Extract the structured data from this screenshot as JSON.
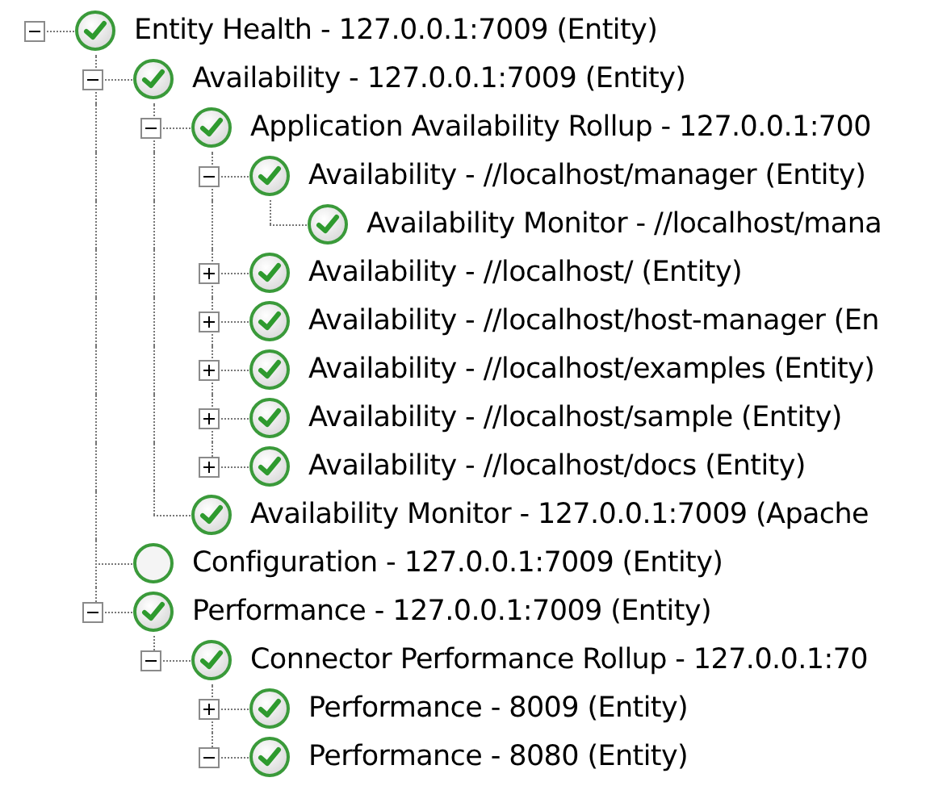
{
  "tree": [
    {
      "label": "Entity Health - 127.0.0.1:7009 (Entity)",
      "healthy": true,
      "expanded": true,
      "children": [
        {
          "label": "Availability - 127.0.0.1:7009 (Entity)",
          "healthy": true,
          "expanded": true,
          "children": [
            {
              "label": "Application Availability Rollup - 127.0.0.1:700",
              "healthy": true,
              "expanded": true,
              "children": [
                {
                  "label": "Availability - //localhost/manager (Entity)",
                  "healthy": true,
                  "expanded": true,
                  "children": [
                    {
                      "label": "Availability Monitor - //localhost/mana",
                      "healthy": true
                    }
                  ]
                },
                {
                  "label": "Availability - //localhost/ (Entity)",
                  "healthy": true,
                  "expanded": false
                },
                {
                  "label": "Availability - //localhost/host-manager (En",
                  "healthy": true,
                  "expanded": false
                },
                {
                  "label": "Availability - //localhost/examples (Entity)",
                  "healthy": true,
                  "expanded": false
                },
                {
                  "label": "Availability - //localhost/sample (Entity)",
                  "healthy": true,
                  "expanded": false
                },
                {
                  "label": "Availability - //localhost/docs (Entity)",
                  "healthy": true,
                  "expanded": false
                }
              ]
            },
            {
              "label": "Availability Monitor - 127.0.0.1:7009 (Apache",
              "healthy": true
            }
          ]
        },
        {
          "label": "Configuration - 127.0.0.1:7009 (Entity)",
          "healthy": false
        },
        {
          "label": "Performance - 127.0.0.1:7009 (Entity)",
          "healthy": true,
          "expanded": true,
          "children": [
            {
              "label": "Connector Performance Rollup - 127.0.0.1:70",
              "healthy": true,
              "expanded": true,
              "children": [
                {
                  "label": "Performance - 8009 (Entity)",
                  "healthy": true,
                  "expanded": false
                },
                {
                  "label": "Performance - 8080 (Entity)",
                  "healthy": true,
                  "expanded": true
                }
              ]
            }
          ]
        }
      ]
    }
  ]
}
